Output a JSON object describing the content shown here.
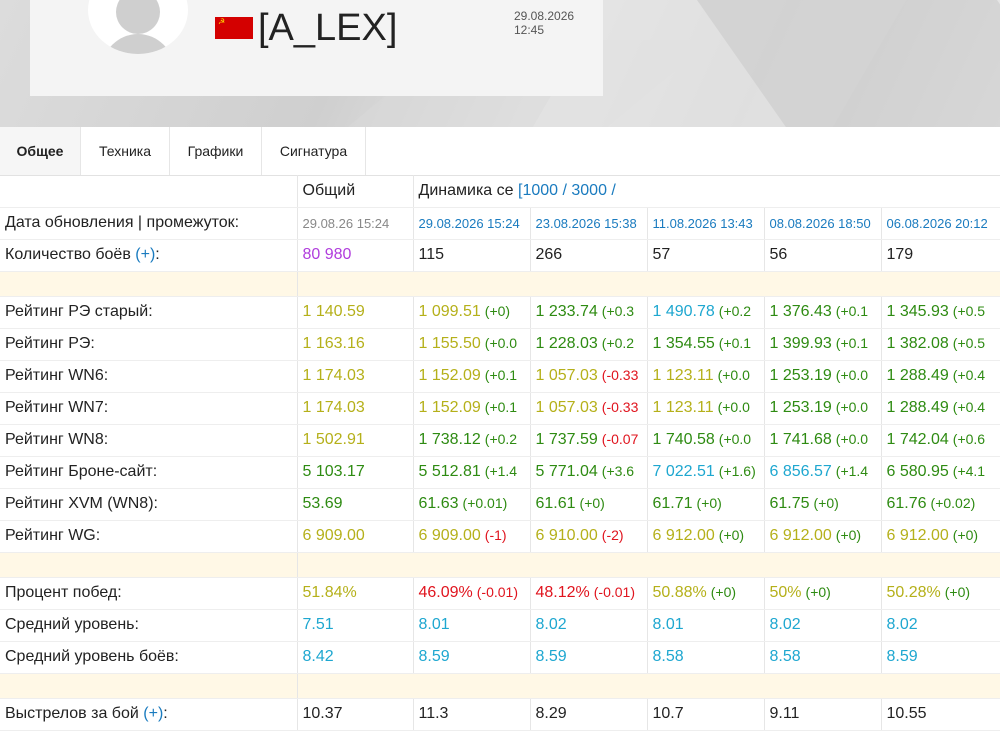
{
  "profile": {
    "nickname": "[A_LEX]",
    "date": "29.08.2026 12:45",
    "flag_symbol": "☭",
    "flag_color": "#d40000"
  },
  "tabs": [
    "Общее",
    "Техника",
    "Графики",
    "Сигнатура"
  ],
  "table": {
    "header": {
      "total": "Общий",
      "dynamics": "Динамика се",
      "dyn_range": "[1000 / 3000 /"
    },
    "update_row": {
      "label": "Дата обновления | промежуток:",
      "total": "29.08.26 15:24",
      "values": [
        "29.08.2026 15:24",
        "23.08.2026 15:38",
        "11.08.2026 13:43",
        "08.08.2026 18:50",
        "06.08.2026 20:12"
      ]
    },
    "battles_row": {
      "label": "Количество боёв",
      "plus": "(+)",
      "suffix": ":",
      "total": "80 980",
      "values": [
        "115",
        "266",
        "57",
        "56",
        "179"
      ]
    },
    "rating_rows": [
      {
        "label": "Рейтинг РЭ старый:",
        "total": "1 140.59",
        "total_color": "yellow",
        "cells": [
          {
            "v": "1 099.51",
            "c": "yellow",
            "d": "(+0)",
            "dc": "d-green"
          },
          {
            "v": "1 233.74",
            "c": "green",
            "d": "(+0.3",
            "dc": "d-green"
          },
          {
            "v": "1 490.78",
            "c": "lightblue",
            "d": "(+0.2",
            "dc": "d-green"
          },
          {
            "v": "1 376.43",
            "c": "green",
            "d": "(+0.1",
            "dc": "d-green"
          },
          {
            "v": "1 345.93",
            "c": "green",
            "d": "(+0.5",
            "dc": "d-green"
          }
        ]
      },
      {
        "label": "Рейтинг РЭ:",
        "total": "1 163.16",
        "total_color": "yellow",
        "cells": [
          {
            "v": "1 155.50",
            "c": "yellow",
            "d": "(+0.0",
            "dc": "d-green"
          },
          {
            "v": "1 228.03",
            "c": "green",
            "d": "(+0.2",
            "dc": "d-green"
          },
          {
            "v": "1 354.55",
            "c": "green",
            "d": "(+0.1",
            "dc": "d-green"
          },
          {
            "v": "1 399.93",
            "c": "green",
            "d": "(+0.1",
            "dc": "d-green"
          },
          {
            "v": "1 382.08",
            "c": "green",
            "d": "(+0.5",
            "dc": "d-green"
          }
        ]
      },
      {
        "label": "Рейтинг WN6:",
        "total": "1 174.03",
        "total_color": "yellow",
        "cells": [
          {
            "v": "1 152.09",
            "c": "yellow",
            "d": "(+0.1",
            "dc": "d-green"
          },
          {
            "v": "1 057.03",
            "c": "yellow",
            "d": "(-0.33",
            "dc": "d-red"
          },
          {
            "v": "1 123.11",
            "c": "yellow",
            "d": "(+0.0",
            "dc": "d-green"
          },
          {
            "v": "1 253.19",
            "c": "green",
            "d": "(+0.0",
            "dc": "d-green"
          },
          {
            "v": "1 288.49",
            "c": "green",
            "d": "(+0.4",
            "dc": "d-green"
          }
        ]
      },
      {
        "label": "Рейтинг WN7:",
        "total": "1 174.03",
        "total_color": "yellow",
        "cells": [
          {
            "v": "1 152.09",
            "c": "yellow",
            "d": "(+0.1",
            "dc": "d-green"
          },
          {
            "v": "1 057.03",
            "c": "yellow",
            "d": "(-0.33",
            "dc": "d-red"
          },
          {
            "v": "1 123.11",
            "c": "yellow",
            "d": "(+0.0",
            "dc": "d-green"
          },
          {
            "v": "1 253.19",
            "c": "green",
            "d": "(+0.0",
            "dc": "d-green"
          },
          {
            "v": "1 288.49",
            "c": "green",
            "d": "(+0.4",
            "dc": "d-green"
          }
        ]
      },
      {
        "label": "Рейтинг WN8:",
        "total": "1 502.91",
        "total_color": "yellow",
        "cells": [
          {
            "v": "1 738.12",
            "c": "green",
            "d": "(+0.2",
            "dc": "d-green"
          },
          {
            "v": "1 737.59",
            "c": "green",
            "d": "(-0.07",
            "dc": "d-red"
          },
          {
            "v": "1 740.58",
            "c": "green",
            "d": "(+0.0",
            "dc": "d-green"
          },
          {
            "v": "1 741.68",
            "c": "green",
            "d": "(+0.0",
            "dc": "d-green"
          },
          {
            "v": "1 742.04",
            "c": "green",
            "d": "(+0.6",
            "dc": "d-green"
          }
        ]
      },
      {
        "label": "Рейтинг Броне-сайт:",
        "total": "5 103.17",
        "total_color": "green",
        "cells": [
          {
            "v": "5 512.81",
            "c": "green",
            "d": "(+1.4",
            "dc": "d-green"
          },
          {
            "v": "5 771.04",
            "c": "green",
            "d": "(+3.6",
            "dc": "d-green"
          },
          {
            "v": "7 022.51",
            "c": "lightblue",
            "d": "(+1.6)",
            "dc": "d-green"
          },
          {
            "v": "6 856.57",
            "c": "lightblue",
            "d": "(+1.4",
            "dc": "d-green"
          },
          {
            "v": "6 580.95",
            "c": "green",
            "d": "(+4.1",
            "dc": "d-green"
          }
        ]
      },
      {
        "label": "Рейтинг XVM (WN8):",
        "total": "53.69",
        "total_color": "green",
        "cells": [
          {
            "v": "61.63",
            "c": "green",
            "d": "(+0.01)",
            "dc": "d-green"
          },
          {
            "v": "61.61",
            "c": "green",
            "d": "(+0)",
            "dc": "d-green"
          },
          {
            "v": "61.71",
            "c": "green",
            "d": "(+0)",
            "dc": "d-green"
          },
          {
            "v": "61.75",
            "c": "green",
            "d": "(+0)",
            "dc": "d-green"
          },
          {
            "v": "61.76",
            "c": "green",
            "d": "(+0.02)",
            "dc": "d-green"
          }
        ]
      },
      {
        "label": "Рейтинг WG:",
        "total": "6 909.00",
        "total_color": "yellow",
        "cells": [
          {
            "v": "6 909.00",
            "c": "yellow",
            "d": "(-1)",
            "dc": "d-red"
          },
          {
            "v": "6 910.00",
            "c": "yellow",
            "d": "(-2)",
            "dc": "d-red"
          },
          {
            "v": "6 912.00",
            "c": "yellow",
            "d": "(+0)",
            "dc": "d-green"
          },
          {
            "v": "6 912.00",
            "c": "yellow",
            "d": "(+0)",
            "dc": "d-green"
          },
          {
            "v": "6 912.00",
            "c": "yellow",
            "d": "(+0)",
            "dc": "d-green"
          }
        ]
      }
    ],
    "perf_rows": [
      {
        "label": "Процент побед:",
        "total": "51.84%",
        "total_color": "yellow",
        "cells": [
          {
            "v": "46.09%",
            "c": "red",
            "d": "(-0.01)",
            "dc": "d-red"
          },
          {
            "v": "48.12%",
            "c": "red",
            "d": "(-0.01)",
            "dc": "d-red"
          },
          {
            "v": "50.88%",
            "c": "yellow",
            "d": "(+0)",
            "dc": "d-green"
          },
          {
            "v": "50%",
            "c": "yellow",
            "d": "(+0)",
            "dc": "d-green"
          },
          {
            "v": "50.28%",
            "c": "yellow",
            "d": "(+0)",
            "dc": "d-green"
          }
        ]
      },
      {
        "label": "Средний уровень:",
        "total": "7.51",
        "total_color": "lightblue",
        "cells": [
          {
            "v": "8.01",
            "c": "lightblue",
            "d": "",
            "dc": "d-green"
          },
          {
            "v": "8.02",
            "c": "lightblue",
            "d": "",
            "dc": "d-green"
          },
          {
            "v": "8.01",
            "c": "lightblue",
            "d": "",
            "dc": "d-green"
          },
          {
            "v": "8.02",
            "c": "lightblue",
            "d": "",
            "dc": "d-green"
          },
          {
            "v": "8.02",
            "c": "lightblue",
            "d": "",
            "dc": "d-green"
          }
        ]
      },
      {
        "label": "Средний уровень боёв:",
        "total": "8.42",
        "total_color": "lightblue",
        "cells": [
          {
            "v": "8.59",
            "c": "lightblue",
            "d": "",
            "dc": "d-green"
          },
          {
            "v": "8.59",
            "c": "lightblue",
            "d": "",
            "dc": "d-green"
          },
          {
            "v": "8.58",
            "c": "lightblue",
            "d": "",
            "dc": "d-green"
          },
          {
            "v": "8.58",
            "c": "lightblue",
            "d": "",
            "dc": "d-green"
          },
          {
            "v": "8.59",
            "c": "lightblue",
            "d": "",
            "dc": "d-green"
          }
        ]
      }
    ],
    "shots_row": {
      "label": "Выстрелов за бой",
      "plus": "(+)",
      "suffix": ":",
      "total": "10.37",
      "values": [
        "11.3",
        "8.29",
        "10.7",
        "9.11",
        "10.55"
      ]
    }
  }
}
